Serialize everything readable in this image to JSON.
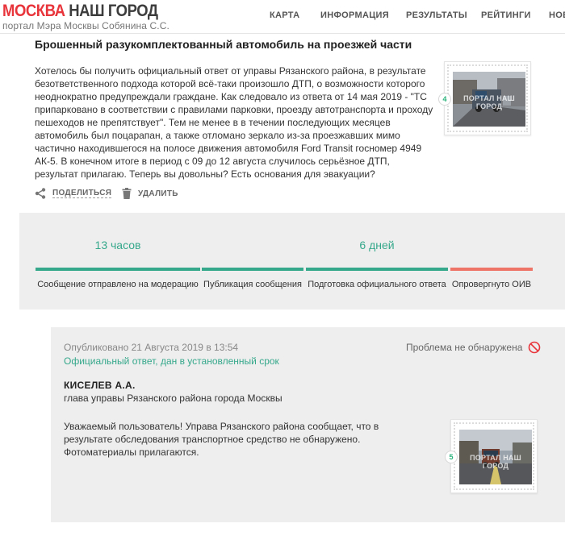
{
  "header": {
    "logo_red": "МОСКВА",
    "logo_dark": "НАШ ГОРОД",
    "logo_sub": "портал Мэра Москвы Собянина С.С.",
    "nav": [
      "КАРТА",
      "ИНФОРМАЦИЯ",
      "РЕЗУЛЬТАТЫ",
      "РЕЙТИНГИ",
      "НОВ"
    ]
  },
  "post": {
    "title": "Брошенный разукомплектованный автомобиль на проезжей части",
    "text": "Хотелось бы получить официальный ответ от управы Рязанского района, в результате безответственного подхода которой всё-таки произошло ДТП, о возможности которого неоднократно предупреждали граждане. Как следовало из ответа от 14 мая 2019 - \"ТС припарковано в соответствии с правилами парковки, проезду автотранспорта и проходу пешеходов не препятствует\". Тем не менее в в течении последующих месяцев автомобиль был поцарапан, а также отломано зеркало из-за проезжавших мимо частично находившегося на полосе движения автомобиля Ford Transit госномер 4949 АК-5. В конечном итоге в период с 09 до 12 августа случилось серьёзное ДТП, результат прилагаю. Теперь вы довольны? Есть основания для эвакуации?",
    "photo_count": "4",
    "photo_watermark": "ПОРТАЛ НАШ ГОРОД",
    "share_label": "ПОДЕЛИТЬСЯ",
    "delete_label": "УДАЛИТЬ"
  },
  "progress": {
    "steps": [
      {
        "value": "13 часов",
        "label": "Сообщение отправлено на модерацию",
        "color": "#35a88b"
      },
      {
        "value": "",
        "label": "Публикация сообщения",
        "color": "#35a88b"
      },
      {
        "value": "6 дней",
        "label": "Подготовка официального ответа",
        "color": "#35a88b"
      },
      {
        "value": "",
        "label": "Опровергнуто ОИВ",
        "color": "#ef7468"
      }
    ]
  },
  "answer": {
    "published": "Опубликовано 21 Августа 2019 в 13:54",
    "status": "Официальный ответ, дан в установленный срок",
    "problem": "Проблема не обнаружена",
    "author_name": "КИСЕЛЕВ А.А.",
    "author_role": "глава управы Рязанского района города Москвы",
    "text": "Уважаемый пользователь! Управа Рязанского района сообщает, что в результате обследования транспортное средство не обнаружено. Фотоматериалы прилагаются.",
    "photo_count": "5",
    "photo_watermark": "ПОРТАЛ НАШ ГОРОД"
  },
  "colors": {
    "accent_red": "#e8343b",
    "accent_green": "#35a88b",
    "bar_red": "#ef7468"
  }
}
